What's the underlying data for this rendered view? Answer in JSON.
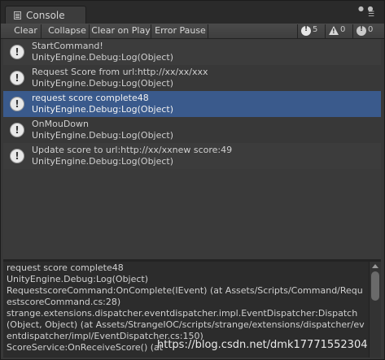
{
  "window": {
    "tab_title": "Console"
  },
  "toolbar": {
    "clear": "Clear",
    "collapse": "Collapse",
    "clear_on_play": "Clear on Play",
    "error_pause": "Error Pause",
    "counts": {
      "info": "5",
      "warning": "0",
      "error": "0"
    }
  },
  "logs": [
    {
      "message": "StartCommand!",
      "source": "UnityEngine.Debug:Log(Object)"
    },
    {
      "message": "Request Score from url:http://xx/xx/xxx",
      "source": "UnityEngine.Debug:Log(Object)"
    },
    {
      "message": "request score complete48",
      "source": "UnityEngine.Debug:Log(Object)",
      "selected": true
    },
    {
      "message": "OnMouDown",
      "source": "UnityEngine.Debug:Log(Object)"
    },
    {
      "message": "Update score to url:http://xx/xxnew score:49",
      "source": "UnityEngine.Debug:Log(Object)"
    }
  ],
  "detail": {
    "text": "request score complete48\nUnityEngine.Debug:Log(Object)\nRequestscoreCommand:OnComplete(IEvent) (at Assets/Scripts/Command/RequestscoreCommand.cs:28)\nstrange.extensions.dispatcher.eventdispatcher.impl.EventDispatcher:Dispatch(Object, Object) (at Assets/StrangeIOC/scripts/strange/extensions/dispatcher/eventdispatcher/impl/EventDispatcher.cs:150)\nScoreService:OnReceiveScore() (at"
  },
  "watermark": "https://blog.csdn.net/dmk17771552304",
  "colors": {
    "selected_row": "#3a5a8c",
    "background": "#383838"
  }
}
